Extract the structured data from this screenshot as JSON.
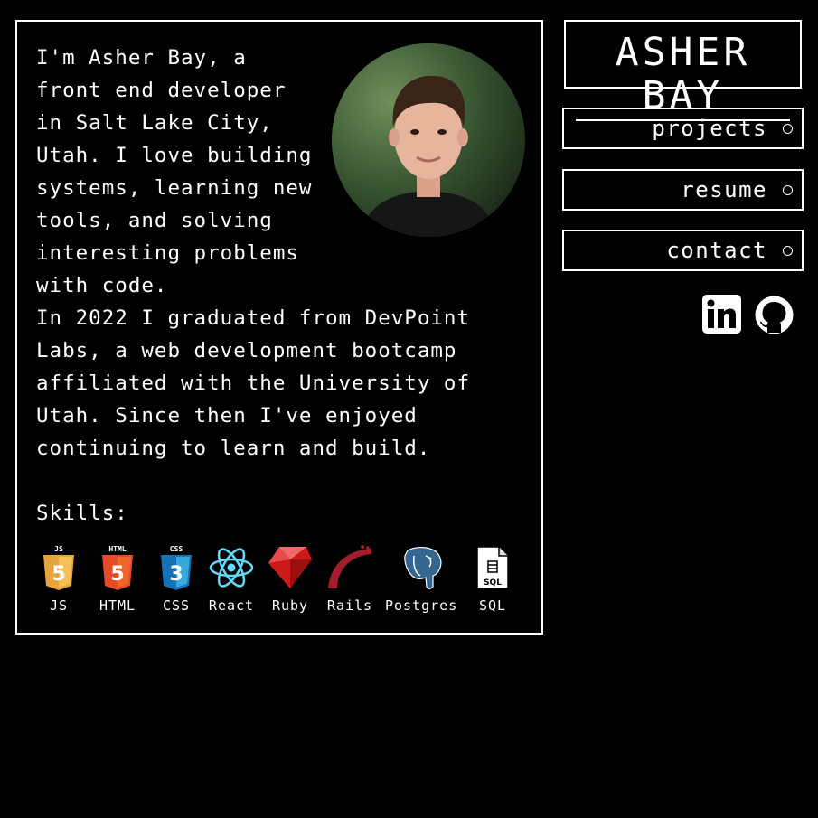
{
  "about": {
    "bio_intro": "I'm Asher Bay, a front end developer in Salt Lake City, Utah. I love building systems, learning new tools, and solving interesting problems with code.",
    "bio_history": "In 2022 I graduated from DevPoint Labs, a web development bootcamp affiliated with the University of Utah. Since then I've enjoyed continuing to learn and build.",
    "skills_label": "Skills:",
    "skills": [
      {
        "label": "JS",
        "icon": "js-shield-icon"
      },
      {
        "label": "HTML",
        "icon": "html5-shield-icon"
      },
      {
        "label": "CSS",
        "icon": "css3-shield-icon"
      },
      {
        "label": "React",
        "icon": "react-atom-icon"
      },
      {
        "label": "Ruby",
        "icon": "ruby-gem-icon"
      },
      {
        "label": "Rails",
        "icon": "rails-track-icon"
      },
      {
        "label": "Postgres",
        "icon": "postgres-elephant-icon"
      },
      {
        "label": "SQL",
        "icon": "sql-file-icon"
      }
    ]
  },
  "header": {
    "title": "ASHER BAY"
  },
  "nav": {
    "projects": "projects",
    "resume": "resume",
    "contact": "contact"
  },
  "social": {
    "linkedin": "linkedin-icon",
    "github": "github-icon"
  },
  "colors": {
    "background": "#000000",
    "foreground": "#ffffff"
  }
}
